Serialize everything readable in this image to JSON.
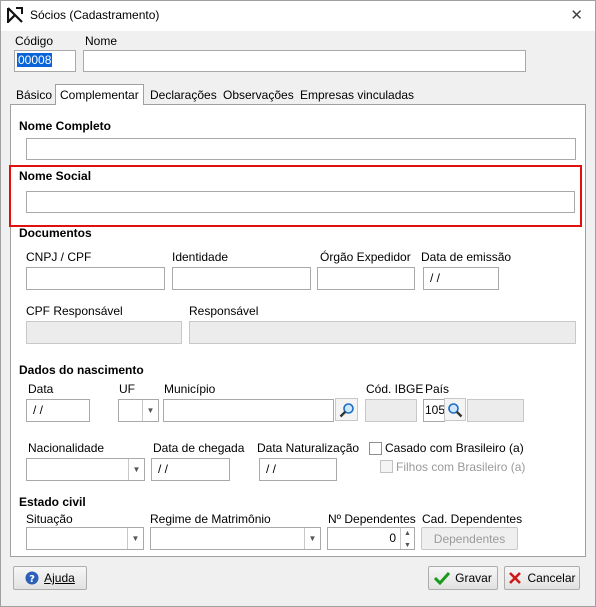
{
  "window": {
    "title": "Sócios (Cadastramento)",
    "close_glyph": "✕"
  },
  "header": {
    "codigo_label": "Código",
    "codigo_value": "00008",
    "nome_label": "Nome",
    "nome_value": ""
  },
  "tabs": [
    {
      "label": "Básico",
      "active": false
    },
    {
      "label": "Complementar",
      "active": true
    },
    {
      "label": "Declarações",
      "active": false
    },
    {
      "label": "Observações",
      "active": false
    },
    {
      "label": "Empresas vinculadas",
      "active": false
    }
  ],
  "complementar": {
    "nome_completo_label": "Nome Completo",
    "nome_completo_value": "",
    "nome_social_label": "Nome Social",
    "nome_social_value": "",
    "documentos": {
      "section_label": "Documentos",
      "cnpj_cpf_label": "CNPJ / CPF",
      "cnpj_cpf_value": "",
      "identidade_label": "Identidade",
      "identidade_value": "",
      "orgao_label": "Órgão Expedidor",
      "orgao_value": "",
      "data_emissao_label": "Data de emissão",
      "data_emissao_value": " / /",
      "cpf_responsavel_label": "CPF Responsável",
      "cpf_responsavel_value": "",
      "responsavel_label": "Responsável",
      "responsavel_value": ""
    },
    "nascimento": {
      "section_label": "Dados do nascimento",
      "data_label": "Data",
      "data_value": " / /",
      "uf_label": "UF",
      "uf_value": "",
      "municipio_label": "Município",
      "municipio_value": "",
      "cod_ibge_label": "Cód. IBGE",
      "cod_ibge_value": "",
      "pais_label": "País",
      "pais_value": "105",
      "pais_name_value": "",
      "nacionalidade_label": "Nacionalidade",
      "nacionalidade_value": "",
      "data_chegada_label": "Data de chegada",
      "data_chegada_value": " / /",
      "data_naturalizacao_label": "Data Naturalização",
      "data_naturalizacao_value": " / /",
      "casado_label": "Casado com Brasileiro (a)",
      "filhos_label": "Filhos com Brasileiro (a)"
    },
    "estado_civil": {
      "section_label": "Estado civil",
      "situacao_label": "Situação",
      "situacao_value": "",
      "regime_label": "Regime de Matrimônio",
      "regime_value": "",
      "dependentes_label": "Nº Dependentes",
      "dependentes_value": "0",
      "cad_dependentes_label": "Cad. Dependentes",
      "dependentes_button": "Dependentes"
    }
  },
  "footer": {
    "ajuda_label": "Ajuda",
    "gravar_label": "Gravar",
    "cancelar_label": "Cancelar"
  },
  "colors": {
    "highlight": "#e01010",
    "ok_green": "#1a9a1a",
    "cancel_red": "#d01818",
    "help_blue": "#2b5fb8"
  }
}
